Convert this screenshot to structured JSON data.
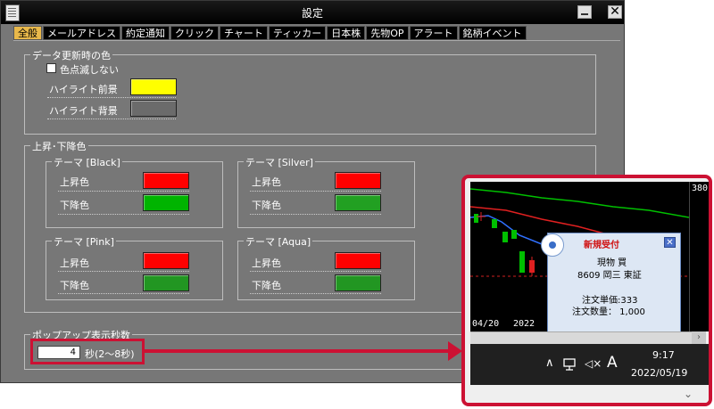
{
  "window": {
    "title": "設定",
    "close_glyph": "✕"
  },
  "tabs": [
    "全般",
    "メールアドレス",
    "約定通知",
    "クリック",
    "チャート",
    "ティッカー",
    "日本株",
    "先物OP",
    "アラート",
    "銘柄イベント"
  ],
  "data_update": {
    "legend": "データ更新時の色",
    "no_flash_label": "色点滅しない",
    "no_flash_checked": false,
    "highlight_fg_label": "ハイライト前景",
    "highlight_fg_color": "#ffff00",
    "highlight_bg_label": "ハイライト背景",
    "highlight_bg_color": "#6b6b6b"
  },
  "updown": {
    "legend": "上昇･下降色",
    "up_label": "上昇色",
    "down_label": "下降色",
    "themes": [
      {
        "name": "テーマ [Black]",
        "up": "#ff0000",
        "down": "#00b400"
      },
      {
        "name": "テーマ [Silver]",
        "up": "#ff0000",
        "down": "#22a022"
      },
      {
        "name": "テーマ [Pink]",
        "up": "#ff0000",
        "down": "#229622"
      },
      {
        "name": "テーマ [Aqua]",
        "up": "#ff0000",
        "down": "#229622"
      }
    ]
  },
  "popup_settings": {
    "legend": "ポップアップ表示秒数",
    "seconds_value": "4",
    "seconds_hint": "秒(2〜8秒)"
  },
  "preview": {
    "price_label": "380",
    "dates": [
      "04/20",
      "2022"
    ],
    "popup": {
      "title": "新規受付",
      "close_glyph": "✕",
      "line1": "現物 買",
      "line2": "8609 岡三 東証",
      "line3": "注文単価:333",
      "line4": "注文数量： 1,000"
    },
    "taskbar": {
      "time": "9:17",
      "date": "2022/05/19",
      "ime": "A",
      "chevron": "∧",
      "mute": "◁×"
    },
    "scroll_arrow_right": "›",
    "scroll_arrow_down": "⌄"
  },
  "colors": {
    "accent_red": "#cc1133",
    "active_tab": "#e8b84a"
  }
}
